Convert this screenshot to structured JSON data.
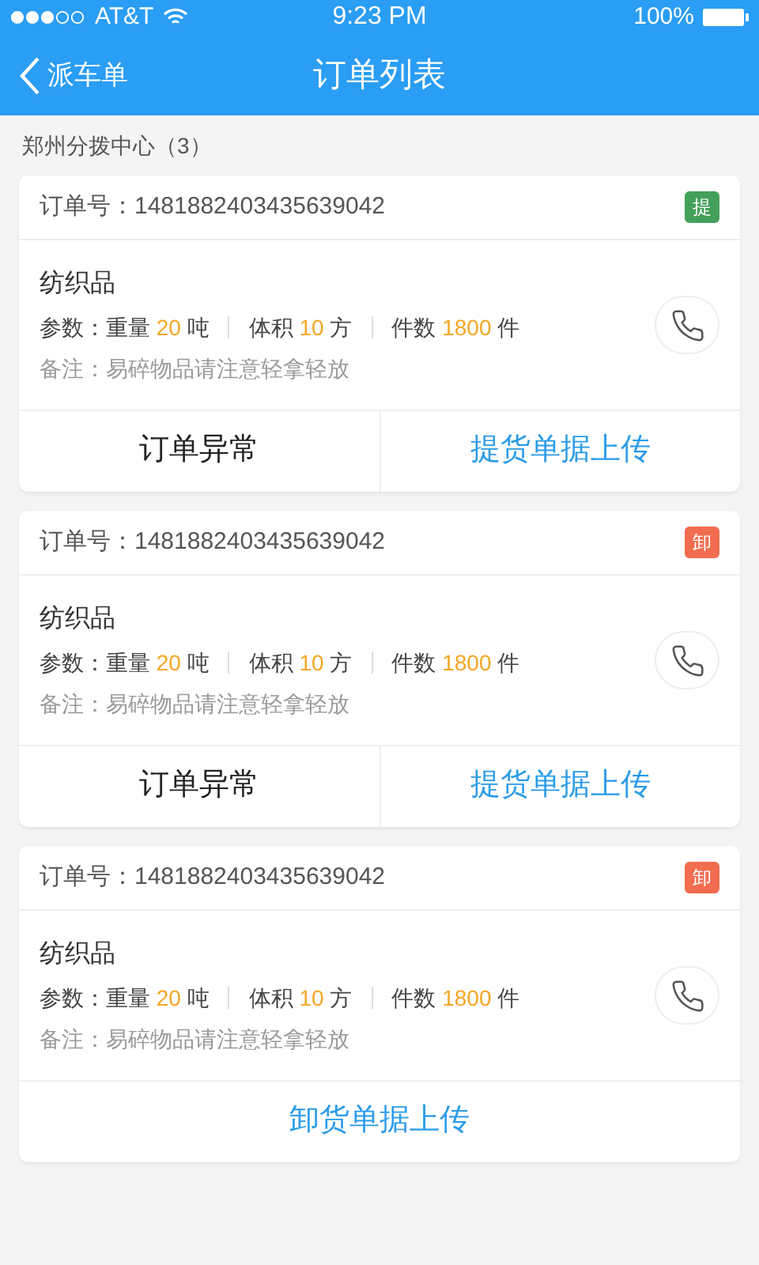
{
  "status_bar": {
    "carrier": "AT&T",
    "time": "9:23 PM",
    "battery": "100%"
  },
  "nav": {
    "back": "派车单",
    "title": "订单列表"
  },
  "section": {
    "title": "郑州分拨中心（3）"
  },
  "orders": [
    {
      "order_label": "订单号：",
      "order_no": "1481882403435639042",
      "tag": {
        "text": "提",
        "color": "#43a05a"
      },
      "name": "纺织品",
      "params_label": "参数：",
      "params": [
        {
          "label": "重量",
          "value": "20",
          "unit": "吨"
        },
        {
          "label": "体积",
          "value": "10",
          "unit": "方"
        },
        {
          "label": "件数",
          "value": "1800",
          "unit": "件"
        }
      ],
      "note": "备注：易碎物品请注意轻拿轻放",
      "actions": [
        {
          "kind": "plain",
          "label": "订单异常"
        },
        {
          "kind": "link",
          "label": "提货单据上传"
        }
      ]
    },
    {
      "order_label": "订单号：",
      "order_no": "1481882403435639042",
      "tag": {
        "text": "卸",
        "color": "#f26c4f"
      },
      "name": "纺织品",
      "params_label": "参数：",
      "params": [
        {
          "label": "重量",
          "value": "20",
          "unit": "吨"
        },
        {
          "label": "体积",
          "value": "10",
          "unit": "方"
        },
        {
          "label": "件数",
          "value": "1800",
          "unit": "件"
        }
      ],
      "note": "备注：易碎物品请注意轻拿轻放",
      "actions": [
        {
          "kind": "plain",
          "label": "订单异常"
        },
        {
          "kind": "link",
          "label": "提货单据上传"
        }
      ]
    },
    {
      "order_label": "订单号：",
      "order_no": "1481882403435639042",
      "tag": {
        "text": "卸",
        "color": "#f26c4f"
      },
      "name": "纺织品",
      "params_label": "参数：",
      "params": [
        {
          "label": "重量",
          "value": "20",
          "unit": "吨"
        },
        {
          "label": "体积",
          "value": "10",
          "unit": "方"
        },
        {
          "label": "件数",
          "value": "1800",
          "unit": "件"
        }
      ],
      "note": "备注：易碎物品请注意轻拿轻放",
      "actions": [
        {
          "kind": "link",
          "label": "卸货单据上传"
        }
      ]
    }
  ]
}
